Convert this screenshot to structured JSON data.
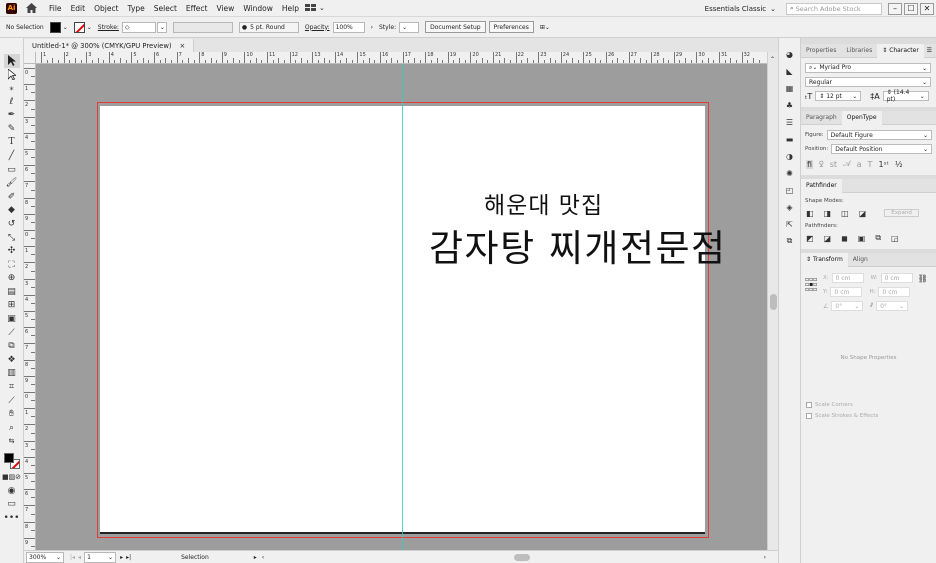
{
  "app": {
    "logo": "Ai",
    "menu": [
      "File",
      "Edit",
      "Object",
      "Type",
      "Select",
      "Effect",
      "View",
      "Window",
      "Help"
    ],
    "workspace": "Essentials Classic",
    "search_placeholder": "Search Adobe Stock",
    "window_controls": [
      "–",
      "☐",
      "✕"
    ]
  },
  "control_bar": {
    "selection": "No Selection",
    "stroke_label": "Stroke:",
    "stroke_value": "",
    "brush_size": "5 pt. Round",
    "opacity_label": "Opacity:",
    "opacity_value": "100%",
    "style_label": "Style:",
    "document_setup": "Document Setup",
    "preferences": "Preferences"
  },
  "document": {
    "tab_title": "Untitled-1* @ 300% (CMYK/GPU Preview)",
    "tab_close": "×",
    "text_line1": "해운대 맛집",
    "text_line2": "감자탕 찌개전문점"
  },
  "rulers": {
    "h_labels": [
      "1",
      "2",
      "3",
      "4",
      "5",
      "6",
      "7",
      "8",
      "9",
      "10",
      "11",
      "12",
      "13",
      "14",
      "15",
      "16",
      "17",
      "18",
      "19",
      "20",
      "21",
      "22",
      "23",
      "24",
      "25",
      "26",
      "27",
      "28",
      "29",
      "30",
      "31",
      "32"
    ],
    "v_labels": [
      "0",
      "1",
      "2",
      "3",
      "4",
      "5",
      "6",
      "7",
      "8",
      "9",
      "0",
      "1",
      "2",
      "3",
      "4",
      "5",
      "6",
      "7",
      "8",
      "9",
      "0",
      "1",
      "2",
      "3",
      "4",
      "5",
      "6",
      "7",
      "8",
      "9"
    ]
  },
  "status_bar": {
    "zoom": "300%",
    "artboard_number": "1",
    "tool_status": "Selection"
  },
  "panels": {
    "top_tabs": [
      "Properties",
      "Libraries",
      "Character"
    ],
    "active_top_tab": "Character",
    "font_family": "Myriad Pro",
    "font_style": "Regular",
    "font_size": "12 pt",
    "leading": "(14.4 pt)",
    "para_tabs": [
      "Paragraph",
      "OpenType"
    ],
    "figure_label": "Figure:",
    "figure_value": "Default Figure",
    "position_label": "Position:",
    "position_value": "Default Position",
    "pathfinder_title": "Pathfinder",
    "shape_modes_label": "Shape Modes:",
    "expand_label": "Expand",
    "pathfinders_label": "Pathfinders:",
    "transform_tabs": [
      "Transform",
      "Align"
    ],
    "x_label": "X:",
    "x_value": "0 cm",
    "y_label": "Y:",
    "y_value": "0 cm",
    "w_label": "W:",
    "w_value": "0 cm",
    "h_label": "H:",
    "h_value": "0 cm",
    "rotate_value": "0°",
    "shear_value": "0°",
    "no_shape_properties": "No Shape Properties",
    "scale_corners": "Scale Corners",
    "scale_strokes": "Scale Strokes & Effects"
  },
  "colors": {
    "bleed_line": "#e43a3a",
    "guide": "#39c8c8",
    "canvas": "#9d9d9d"
  }
}
